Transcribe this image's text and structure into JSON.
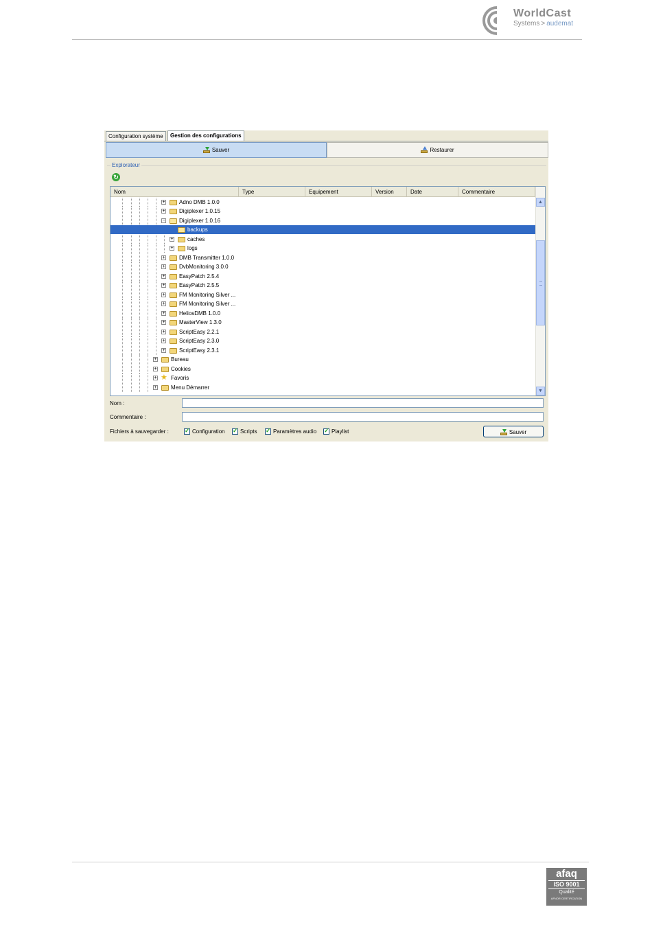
{
  "header": {
    "logo_title": "WorldCast",
    "logo_sub_left": "Systems",
    "logo_sub_right": "audemat",
    "logo_sub_sep": ">"
  },
  "footer": {
    "badge_brand": "afaq",
    "badge_iso": "ISO 9001",
    "badge_quality": "Qualité",
    "badge_org": "AFNOR CERTIFICATION"
  },
  "app": {
    "tabs": [
      {
        "label": "Configuration système"
      },
      {
        "label": "Gestion des configurations"
      }
    ],
    "top_buttons": {
      "save": "Sauver",
      "restore": "Restaurer"
    },
    "group_label": "Explorateur",
    "table": {
      "columns": [
        "Nom",
        "Type",
        "Equipement",
        "Version",
        "Date",
        "Commentaire"
      ],
      "rows": [
        {
          "label": "Adno DMB 1.0.0"
        },
        {
          "label": "Digiplexer 1.0.15"
        },
        {
          "label": "Digiplexer 1.0.16"
        },
        {
          "label": "backups"
        },
        {
          "label": "caches"
        },
        {
          "label": "logs"
        },
        {
          "label": "DMB Transmitter 1.0.0"
        },
        {
          "label": "DvbMonitoring 3.0.0"
        },
        {
          "label": "EasyPatch 2.5.4"
        },
        {
          "label": "EasyPatch 2.5.5"
        },
        {
          "label": "FM Monitoring Silver ..."
        },
        {
          "label": "FM Monitoring Silver ..."
        },
        {
          "label": "HeliosDMB 1.0.0"
        },
        {
          "label": "MasterView 1.3.0"
        },
        {
          "label": "ScriptEasy 2.2.1"
        },
        {
          "label": "ScriptEasy 2.3.0"
        },
        {
          "label": "ScriptEasy 2.3.1"
        },
        {
          "label": "Bureau"
        },
        {
          "label": "Cookies"
        },
        {
          "label": "Favoris"
        },
        {
          "label": "Menu Démarrer"
        }
      ],
      "selected_row": "backups"
    },
    "form": {
      "name_label": "Nom :",
      "name_value": "",
      "comment_label": "Commentaire :",
      "comment_value": "",
      "files_label": "Fichiers à sauvegarder :",
      "checkboxes": [
        {
          "label": "Configuration",
          "checked": true
        },
        {
          "label": "Scripts",
          "checked": true
        },
        {
          "label": "Paramètres audio",
          "checked": true
        },
        {
          "label": "Playlist",
          "checked": true
        }
      ],
      "save_button": "Sauver"
    }
  }
}
